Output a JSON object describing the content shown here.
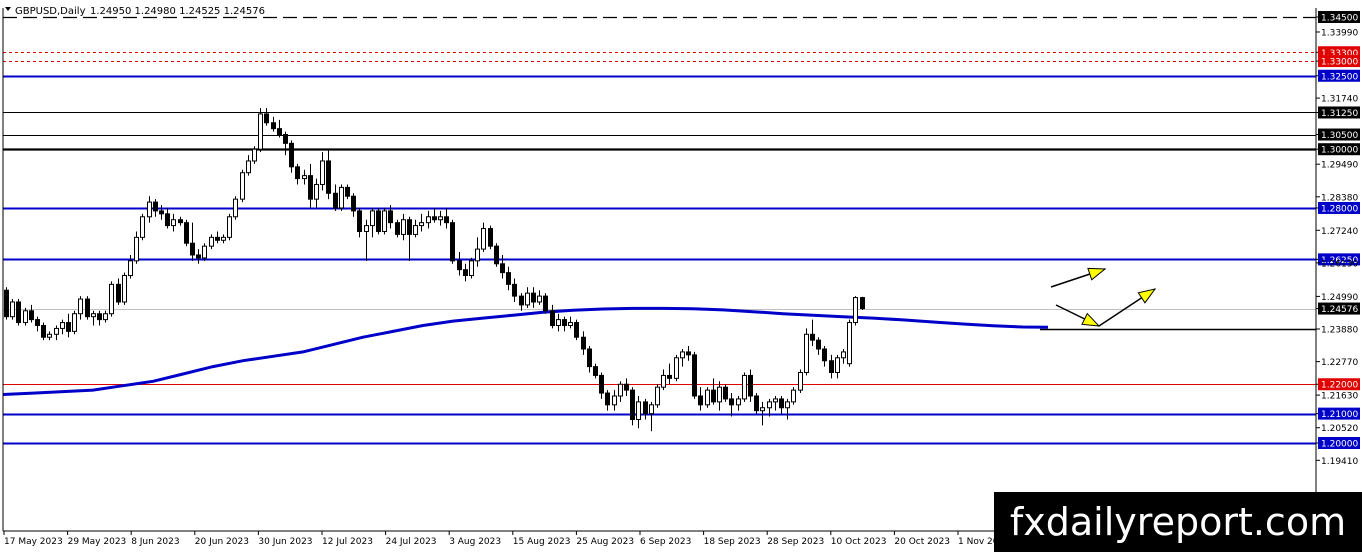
{
  "header": {
    "symbol": "GBPUSD,Daily",
    "ohlc": "1.24950 1.24980 1.24525 1.24576"
  },
  "watermark": "fxdailyreport.com",
  "colors": {
    "blue_level": "#0000c8",
    "red_level": "#e00000",
    "black_level": "#000000",
    "ma": "#0000c8",
    "arrow": "#ffff00",
    "price_line": "#c0c0c0"
  },
  "chart_data": {
    "type": "candlestick",
    "ylim": [
      1.188,
      1.349
    ],
    "y_ticks": [
      "1.34500",
      "1.33990",
      "1.33300",
      "1.33000",
      "1.32500",
      "1.31740",
      "1.31250",
      "1.30500",
      "1.30000",
      "1.29490",
      "1.28380",
      "1.28000",
      "1.27240",
      "1.26250",
      "1.26130",
      "1.24990",
      "1.24576",
      "1.23880",
      "1.22770",
      "1.22000",
      "1.21630",
      "1.21000",
      "1.20520",
      "1.20000",
      "1.19410"
    ],
    "x_labels": [
      "17 May 2023",
      "29 May 2023",
      "8 Jun 2023",
      "20 Jun 2023",
      "30 Jun 2023",
      "12 Jul 2023",
      "24 Jul 2023",
      "3 Aug 2023",
      "15 Aug 2023",
      "25 Aug 2023",
      "6 Sep 2023",
      "18 Sep 2023",
      "28 Sep 2023",
      "10 Oct 2023",
      "20 Oct 2023",
      "1 Nov 2023"
    ],
    "levels": [
      {
        "price": 1.345,
        "label": "1.34500",
        "style": "dashed",
        "color": "black"
      },
      {
        "price": 1.333,
        "label": "1.33300",
        "style": "dotted",
        "color": "red"
      },
      {
        "price": 1.33,
        "label": "1.33000",
        "style": "dotted",
        "color": "red"
      },
      {
        "price": 1.325,
        "label": "1.32500",
        "style": "solid",
        "color": "blue"
      },
      {
        "price": 1.3125,
        "label": "1.31250",
        "style": "thin",
        "color": "black"
      },
      {
        "price": 1.305,
        "label": "1.30500",
        "style": "thin",
        "color": "black"
      },
      {
        "price": 1.3,
        "label": "1.30000",
        "style": "thick",
        "color": "black"
      },
      {
        "price": 1.28,
        "label": "1.28000",
        "style": "solid",
        "color": "blue"
      },
      {
        "price": 1.2625,
        "label": "1.26250",
        "style": "solid",
        "color": "blue"
      },
      {
        "price": 1.22,
        "label": "1.22000",
        "style": "thin",
        "color": "red"
      },
      {
        "price": 1.21,
        "label": "1.21000",
        "style": "solid",
        "color": "blue"
      },
      {
        "price": 1.2,
        "label": "1.20000",
        "style": "solid",
        "color": "blue"
      }
    ],
    "current_price": {
      "price": 1.24576,
      "label": "1.24576"
    },
    "support_line": {
      "price": 1.2388
    },
    "candles": [
      [
        1.252,
        1.253,
        1.242,
        1.243
      ],
      [
        1.243,
        1.249,
        1.242,
        1.248
      ],
      [
        1.248,
        1.249,
        1.24,
        1.241
      ],
      [
        1.241,
        1.246,
        1.24,
        1.245
      ],
      [
        1.245,
        1.247,
        1.241,
        1.242
      ],
      [
        1.242,
        1.243,
        1.238,
        1.24
      ],
      [
        1.24,
        1.241,
        1.235,
        1.236
      ],
      [
        1.236,
        1.238,
        1.235,
        1.237
      ],
      [
        1.237,
        1.24,
        1.235,
        1.239
      ],
      [
        1.239,
        1.242,
        1.237,
        1.241
      ],
      [
        1.241,
        1.244,
        1.236,
        1.238
      ],
      [
        1.238,
        1.245,
        1.237,
        1.244
      ],
      [
        1.244,
        1.25,
        1.242,
        1.249
      ],
      [
        1.249,
        1.25,
        1.242,
        1.243
      ],
      [
        1.243,
        1.245,
        1.24,
        1.244
      ],
      [
        1.244,
        1.245,
        1.24,
        1.242
      ],
      [
        1.242,
        1.245,
        1.241,
        1.244
      ],
      [
        1.244,
        1.255,
        1.243,
        1.254
      ],
      [
        1.254,
        1.256,
        1.247,
        1.248
      ],
      [
        1.248,
        1.258,
        1.247,
        1.257
      ],
      [
        1.257,
        1.264,
        1.256,
        1.262
      ],
      [
        1.262,
        1.272,
        1.261,
        1.27
      ],
      [
        1.27,
        1.278,
        1.269,
        1.277
      ],
      [
        1.277,
        1.284,
        1.275,
        1.282
      ],
      [
        1.282,
        1.283,
        1.277,
        1.279
      ],
      [
        1.279,
        1.281,
        1.276,
        1.278
      ],
      [
        1.278,
        1.28,
        1.273,
        1.274
      ],
      [
        1.274,
        1.278,
        1.272,
        1.276
      ],
      [
        1.276,
        1.277,
        1.274,
        1.275
      ],
      [
        1.275,
        1.276,
        1.267,
        1.268
      ],
      [
        1.268,
        1.275,
        1.262,
        1.264
      ],
      [
        1.264,
        1.266,
        1.261,
        1.263
      ],
      [
        1.263,
        1.268,
        1.262,
        1.267
      ],
      [
        1.267,
        1.271,
        1.266,
        1.27
      ],
      [
        1.27,
        1.272,
        1.268,
        1.269
      ],
      [
        1.269,
        1.271,
        1.268,
        1.27
      ],
      [
        1.27,
        1.278,
        1.269,
        1.277
      ],
      [
        1.277,
        1.284,
        1.276,
        1.283
      ],
      [
        1.283,
        1.293,
        1.282,
        1.292
      ],
      [
        1.292,
        1.298,
        1.291,
        1.296
      ],
      [
        1.296,
        1.301,
        1.295,
        1.3
      ],
      [
        1.3,
        1.314,
        1.299,
        1.312
      ],
      [
        1.312,
        1.314,
        1.308,
        1.309
      ],
      [
        1.309,
        1.311,
        1.306,
        1.307
      ],
      [
        1.307,
        1.31,
        1.304,
        1.305
      ],
      [
        1.305,
        1.306,
        1.298,
        1.302
      ],
      [
        1.302,
        1.303,
        1.292,
        1.294
      ],
      [
        1.294,
        1.295,
        1.288,
        1.29
      ],
      [
        1.29,
        1.293,
        1.288,
        1.291
      ],
      [
        1.291,
        1.295,
        1.28,
        1.283
      ],
      [
        1.283,
        1.29,
        1.28,
        1.288
      ],
      [
        1.288,
        1.299,
        1.286,
        1.296
      ],
      [
        1.296,
        1.3,
        1.283,
        1.285
      ],
      [
        1.285,
        1.288,
        1.279,
        1.28
      ],
      [
        1.28,
        1.288,
        1.279,
        1.287
      ],
      [
        1.287,
        1.288,
        1.283,
        1.284
      ],
      [
        1.284,
        1.285,
        1.277,
        1.279
      ],
      [
        1.279,
        1.28,
        1.27,
        1.272
      ],
      [
        1.272,
        1.276,
        1.262,
        1.274
      ],
      [
        1.274,
        1.28,
        1.27,
        1.279
      ],
      [
        1.279,
        1.28,
        1.271,
        1.272
      ],
      [
        1.272,
        1.28,
        1.271,
        1.279
      ],
      [
        1.279,
        1.281,
        1.273,
        1.275
      ],
      [
        1.275,
        1.276,
        1.27,
        1.271
      ],
      [
        1.271,
        1.278,
        1.269,
        1.276
      ],
      [
        1.276,
        1.277,
        1.262,
        1.271
      ],
      [
        1.271,
        1.276,
        1.27,
        1.274
      ],
      [
        1.274,
        1.278,
        1.272,
        1.275
      ],
      [
        1.275,
        1.279,
        1.273,
        1.277
      ],
      [
        1.277,
        1.28,
        1.275,
        1.276
      ],
      [
        1.276,
        1.279,
        1.274,
        1.277
      ],
      [
        1.277,
        1.28,
        1.273,
        1.275
      ],
      [
        1.275,
        1.276,
        1.261,
        1.262
      ],
      [
        1.262,
        1.265,
        1.257,
        1.259
      ],
      [
        1.259,
        1.261,
        1.255,
        1.257
      ],
      [
        1.257,
        1.263,
        1.256,
        1.262
      ],
      [
        1.262,
        1.27,
        1.26,
        1.266
      ],
      [
        1.266,
        1.275,
        1.265,
        1.273
      ],
      [
        1.273,
        1.274,
        1.266,
        1.267
      ],
      [
        1.267,
        1.268,
        1.26,
        1.261
      ],
      [
        1.261,
        1.264,
        1.256,
        1.258
      ],
      [
        1.258,
        1.26,
        1.252,
        1.254
      ],
      [
        1.254,
        1.256,
        1.248,
        1.25
      ],
      [
        1.25,
        1.251,
        1.245,
        1.247
      ],
      [
        1.247,
        1.253,
        1.246,
        1.251
      ],
      [
        1.251,
        1.253,
        1.246,
        1.248
      ],
      [
        1.248,
        1.252,
        1.247,
        1.25
      ],
      [
        1.25,
        1.251,
        1.244,
        1.245
      ],
      [
        1.245,
        1.247,
        1.239,
        1.24
      ],
      [
        1.24,
        1.244,
        1.238,
        1.242
      ],
      [
        1.242,
        1.243,
        1.238,
        1.24
      ],
      [
        1.24,
        1.243,
        1.239,
        1.241
      ],
      [
        1.241,
        1.242,
        1.235,
        1.236
      ],
      [
        1.236,
        1.238,
        1.23,
        1.232
      ],
      [
        1.232,
        1.233,
        1.224,
        1.226
      ],
      [
        1.226,
        1.227,
        1.222,
        1.223
      ],
      [
        1.223,
        1.224,
        1.215,
        1.217
      ],
      [
        1.217,
        1.218,
        1.211,
        1.213
      ],
      [
        1.213,
        1.218,
        1.211,
        1.216
      ],
      [
        1.216,
        1.221,
        1.214,
        1.22
      ],
      [
        1.22,
        1.222,
        1.216,
        1.218
      ],
      [
        1.218,
        1.219,
        1.206,
        1.208
      ],
      [
        1.208,
        1.216,
        1.205,
        1.214
      ],
      [
        1.214,
        1.215,
        1.208,
        1.21
      ],
      [
        1.21,
        1.214,
        1.204,
        1.213
      ],
      [
        1.213,
        1.22,
        1.212,
        1.219
      ],
      [
        1.219,
        1.225,
        1.218,
        1.223
      ],
      [
        1.223,
        1.227,
        1.22,
        1.222
      ],
      [
        1.222,
        1.23,
        1.221,
        1.229
      ],
      [
        1.229,
        1.232,
        1.226,
        1.231
      ],
      [
        1.231,
        1.233,
        1.228,
        1.23
      ],
      [
        1.23,
        1.231,
        1.215,
        1.216
      ],
      [
        1.216,
        1.219,
        1.211,
        1.213
      ],
      [
        1.213,
        1.219,
        1.212,
        1.218
      ],
      [
        1.218,
        1.222,
        1.213,
        1.214
      ],
      [
        1.214,
        1.221,
        1.211,
        1.219
      ],
      [
        1.219,
        1.22,
        1.214,
        1.215
      ],
      [
        1.215,
        1.217,
        1.209,
        1.213
      ],
      [
        1.213,
        1.216,
        1.211,
        1.215
      ],
      [
        1.215,
        1.224,
        1.214,
        1.223
      ],
      [
        1.223,
        1.225,
        1.214,
        1.216
      ],
      [
        1.216,
        1.217,
        1.21,
        1.211
      ],
      [
        1.211,
        1.214,
        1.206,
        1.212
      ],
      [
        1.212,
        1.215,
        1.209,
        1.214
      ],
      [
        1.214,
        1.216,
        1.211,
        1.215
      ],
      [
        1.215,
        1.216,
        1.21,
        1.212
      ],
      [
        1.212,
        1.215,
        1.208,
        1.214
      ],
      [
        1.214,
        1.219,
        1.213,
        1.218
      ],
      [
        1.218,
        1.225,
        1.217,
        1.224
      ],
      [
        1.224,
        1.239,
        1.223,
        1.237
      ],
      [
        1.237,
        1.242,
        1.233,
        1.235
      ],
      [
        1.235,
        1.236,
        1.23,
        1.232
      ],
      [
        1.232,
        1.233,
        1.226,
        1.228
      ],
      [
        1.228,
        1.23,
        1.222,
        1.224
      ],
      [
        1.224,
        1.23,
        1.222,
        1.229
      ],
      [
        1.229,
        1.232,
        1.227,
        1.231
      ],
      [
        1.227,
        1.242,
        1.226,
        1.241
      ],
      [
        1.241,
        1.25,
        1.24,
        1.2495
      ],
      [
        1.2495,
        1.2498,
        1.24525,
        1.24576
      ]
    ],
    "moving_average": [
      [
        0,
        1.2165
      ],
      [
        30,
        1.217
      ],
      [
        60,
        1.2175
      ],
      [
        90,
        1.218
      ],
      [
        120,
        1.2195
      ],
      [
        150,
        1.221
      ],
      [
        180,
        1.2235
      ],
      [
        210,
        1.226
      ],
      [
        240,
        1.228
      ],
      [
        270,
        1.2295
      ],
      [
        300,
        1.231
      ],
      [
        330,
        1.2335
      ],
      [
        360,
        1.236
      ],
      [
        390,
        1.238
      ],
      [
        420,
        1.24
      ],
      [
        450,
        1.2415
      ],
      [
        480,
        1.2425
      ],
      [
        510,
        1.2435
      ],
      [
        540,
        1.2445
      ],
      [
        570,
        1.2452
      ],
      [
        600,
        1.2456
      ],
      [
        630,
        1.2458
      ],
      [
        660,
        1.2458
      ],
      [
        690,
        1.2457
      ],
      [
        720,
        1.2453
      ],
      [
        750,
        1.2447
      ],
      [
        780,
        1.244
      ],
      [
        810,
        1.2435
      ],
      [
        840,
        1.243
      ],
      [
        870,
        1.2425
      ],
      [
        900,
        1.2419
      ],
      [
        930,
        1.2412
      ],
      [
        960,
        1.2405
      ],
      [
        990,
        1.2399
      ],
      [
        1020,
        1.2395
      ],
      [
        1045,
        1.2394
      ]
    ]
  }
}
